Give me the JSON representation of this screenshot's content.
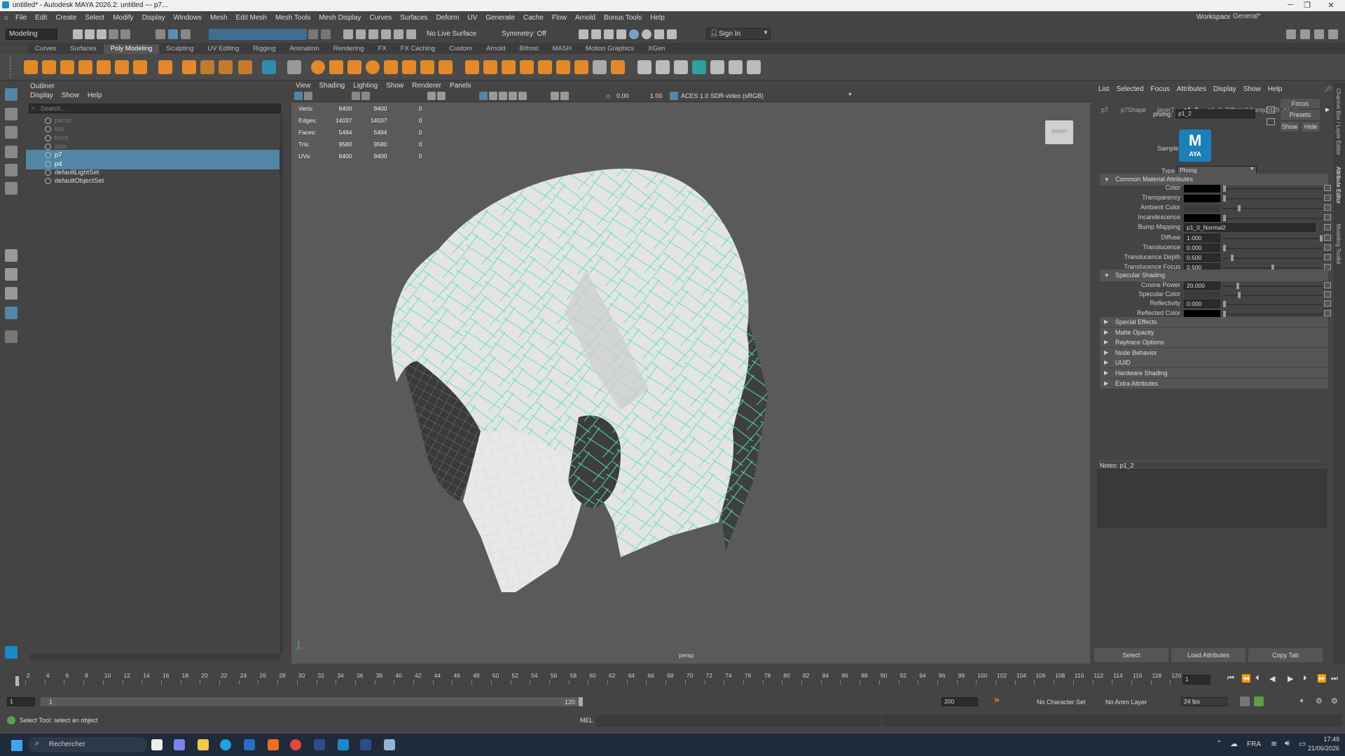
{
  "window": {
    "title": "untitled* - Autodesk MAYA 2026.2: untitled   ---   p7..."
  },
  "menu": [
    "File",
    "Edit",
    "Create",
    "Select",
    "Modify",
    "Display",
    "Windows",
    "Mesh",
    "Edit Mesh",
    "Mesh Tools",
    "Mesh Display",
    "Curves",
    "Surfaces",
    "Deform",
    "UV",
    "Generate",
    "Cache",
    "Flow",
    "Arnold",
    "Bonus Tools",
    "Help"
  ],
  "workspace": {
    "label": "Workspace:",
    "value": "General*"
  },
  "statusline": {
    "mode": "Modeling",
    "live_surface": "No Live Surface",
    "symmetry": "Symmetry: Off",
    "sign_in": "Sign In"
  },
  "shelf_tabs": [
    "Curves",
    "Surfaces",
    "Poly Modeling",
    "Sculpting",
    "UV Editing",
    "Rigging",
    "Animation",
    "Rendering",
    "FX",
    "FX Caching",
    "Custom",
    "Arnold",
    "Bifrost",
    "MASH",
    "Motion Graphics",
    "XGen"
  ],
  "shelf_active": "Poly Modeling",
  "outliner": {
    "title": "Outliner",
    "menus": [
      "Display",
      "Show",
      "Help"
    ],
    "search_placeholder": "Search...",
    "items": [
      {
        "name": "persp",
        "state": "dim"
      },
      {
        "name": "top",
        "state": "dim"
      },
      {
        "name": "front",
        "state": "dim"
      },
      {
        "name": "side",
        "state": "dim"
      },
      {
        "name": "p7",
        "state": "sel"
      },
      {
        "name": "p4",
        "state": "sel"
      },
      {
        "name": "defaultLightSet",
        "state": "normal"
      },
      {
        "name": "defaultObjectSet",
        "state": "normal"
      }
    ]
  },
  "viewport": {
    "menus": [
      "View",
      "Shading",
      "Lighting",
      "Show",
      "Renderer",
      "Panels"
    ],
    "exposure": "0.00",
    "gamma": "1.00",
    "colorspace": "ACES 1.0 SDR-video (sRGB)",
    "camera_label": "persp",
    "cube_label": "RIGHT",
    "hud": [
      {
        "label": "Verts:",
        "a": "9400",
        "b": "9400",
        "c": "0"
      },
      {
        "label": "Edges:",
        "a": "14037",
        "b": "14037",
        "c": "0"
      },
      {
        "label": "Faces:",
        "a": "5494",
        "b": "5494",
        "c": "0"
      },
      {
        "label": "Tris:",
        "a": "9580",
        "b": "9580",
        "c": "0"
      },
      {
        "label": "UVs:",
        "a": "9400",
        "b": "9400",
        "c": "0"
      }
    ]
  },
  "attribute_editor": {
    "menus": [
      "List",
      "Selected",
      "Focus",
      "Attributes",
      "Display",
      "Show",
      "Help"
    ],
    "tabs": [
      "p7",
      "p7Shape",
      "layer7",
      "p1_2",
      "p1_0_Diffuse2",
      "bump2d29",
      "p1_0"
    ],
    "active_tab": "p1_2",
    "node_label": "phong:",
    "node_name": "p1_2",
    "focus": "Focus",
    "presets": "Presets",
    "show": "Show",
    "hide": "Hide",
    "sample_label": "Sample",
    "sample_logo": "M",
    "sample_logo_sub": "AYA",
    "type_label": "Type",
    "type_value": "Phong",
    "sections": {
      "common": "Common Material Attributes",
      "specular": "Specular Shading",
      "collapsed": [
        "Special Effects",
        "Matte Opacity",
        "Raytrace Options",
        "Node Behavior",
        "UUID",
        "Hardware Shading",
        "Extra Attributes"
      ]
    },
    "common_attrs": [
      {
        "label": "Color",
        "kind": "swatch",
        "value": "",
        "level": 0.0
      },
      {
        "label": "Transparency",
        "kind": "swatch",
        "value": "",
        "level": 0.0
      },
      {
        "label": "Ambient Color",
        "kind": "swatch_grey",
        "value": "",
        "level": 0.15
      },
      {
        "label": "Incandescence",
        "kind": "swatch",
        "value": "",
        "level": 0.0
      },
      {
        "label": "Bump Mapping",
        "kind": "text",
        "value": "p1_0_Normal2",
        "level": null
      },
      {
        "label": "Diffuse",
        "kind": "num",
        "value": "1.000",
        "level": 1.0
      },
      {
        "label": "Translucence",
        "kind": "num",
        "value": "0.000",
        "level": 0.0
      },
      {
        "label": "Translucence Depth",
        "kind": "num",
        "value": "0.500",
        "level": 0.08
      },
      {
        "label": "Translucence Focus",
        "kind": "num",
        "value": "0.500",
        "level": 0.5
      }
    ],
    "spec_attrs": [
      {
        "label": "Cosine Power",
        "kind": "num",
        "value": "20.000",
        "level": 0.14
      },
      {
        "label": "Specular Color",
        "kind": "swatch_grey",
        "value": "",
        "level": 0.15
      },
      {
        "label": "Reflectivity",
        "kind": "num",
        "value": "0.000",
        "level": 0.0
      },
      {
        "label": "Reflected Color",
        "kind": "swatch",
        "value": "",
        "level": 0.0
      }
    ],
    "notes_label": "Notes:  p1_2",
    "buttons": [
      "Select",
      "Load Attributes",
      "Copy Tab"
    ]
  },
  "side_tabs": [
    "Channel Box / Layer Editor",
    "Attribute Editor",
    "Modeling Toolkit"
  ],
  "timeline": {
    "ticks": [
      "1",
      "2",
      "4",
      "6",
      "8",
      "10",
      "12",
      "14",
      "16",
      "18",
      "20",
      "22",
      "24",
      "26",
      "28",
      "30",
      "32",
      "34",
      "36",
      "38",
      "40",
      "42",
      "44",
      "46",
      "48",
      "50",
      "52",
      "54",
      "56",
      "58",
      "60",
      "62",
      "64",
      "66",
      "68",
      "70",
      "72",
      "74",
      "76",
      "78",
      "80",
      "82",
      "84",
      "86",
      "88",
      "90",
      "92",
      "94",
      "96",
      "98",
      "100",
      "102",
      "104",
      "106",
      "108",
      "110",
      "112",
      "114",
      "116",
      "118",
      "120"
    ],
    "current": "1"
  },
  "range": {
    "start": "1",
    "start2": "1",
    "end": "120",
    "end2": "200",
    "character": "No Character Set",
    "anim_layer": "No Anim Layer",
    "fps": "24 fps"
  },
  "helpline": {
    "message": "Select Tool: select an object",
    "mel": "MEL"
  },
  "taskbar": {
    "search": "Rechercher",
    "lang": "FRA",
    "time": "17:49",
    "date": "21/06/2026"
  }
}
